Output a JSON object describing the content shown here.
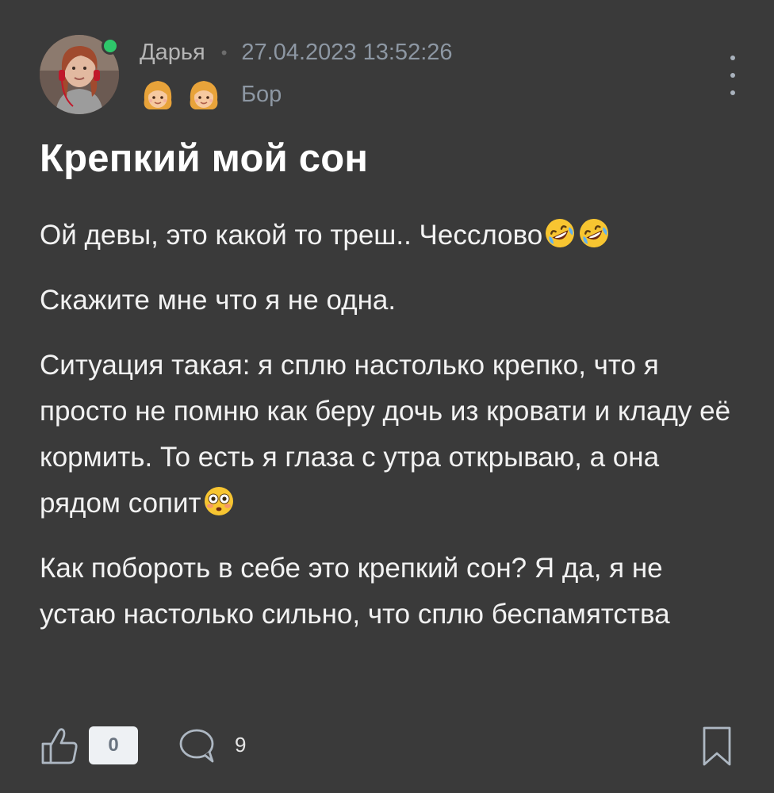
{
  "post": {
    "author": {
      "name": "Дарья",
      "online": true,
      "separator": "•",
      "timestamp": "27.04.2023 13:52:26",
      "badges": [
        "girl-emoji",
        "girl-emoji"
      ],
      "city": "Бор"
    },
    "title": "Крепкий мой сон",
    "paragraphs": [
      {
        "text": "Ой девы, это какой то треш.. Чесслово",
        "emojis": [
          "rolling-laughing-emoji",
          "rolling-laughing-emoji"
        ]
      },
      {
        "text": "Скажите мне что я не одна.",
        "emojis": []
      },
      {
        "text": "Ситуация такая: я сплю настолько крепко, что я просто не помню как беру дочь из кровати и кладу её кормить. То есть я глаза с утра открываю, а она рядом сопит",
        "emojis": [
          "flushed-emoji"
        ]
      },
      {
        "text": "Как побороть в себе это крепкий сон? Я да, я не устаю настолько сильно, что сплю беспамятства",
        "emojis": []
      }
    ]
  },
  "footer": {
    "like_count": "0",
    "comment_count": "9",
    "icons": {
      "like": "thumbs-up-icon",
      "comment": "comment-bubble-icon",
      "bookmark": "bookmark-icon"
    }
  },
  "colors": {
    "background": "#3a3a3a",
    "online": "#2ec76a",
    "meta": "#8d97a3"
  }
}
